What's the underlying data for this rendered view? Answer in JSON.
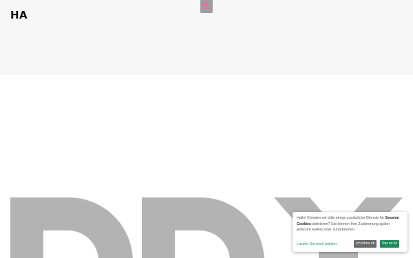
{
  "header": {
    "logo_text": "HA"
  },
  "cookie_banner": {
    "text_before": "Hallo! Könnten wir bitte einige zusätzliche Dienste für ",
    "text_bold": "Session Cookies",
    "text_after": " aktivieren? Sie können Ihre Zustimmung später jederzeit ändern oder zurückziehen.",
    "choose_link": "Lassen Sie mich wählen",
    "decline_label": "Ich lehne ab",
    "accept_label": "Das ist ok"
  },
  "colors": {
    "header_bg": "#f7f7f7",
    "hero_shape": "#b3b3b3",
    "accent_green": "#1e8c5a",
    "decline_gray": "#6b6b6b"
  }
}
